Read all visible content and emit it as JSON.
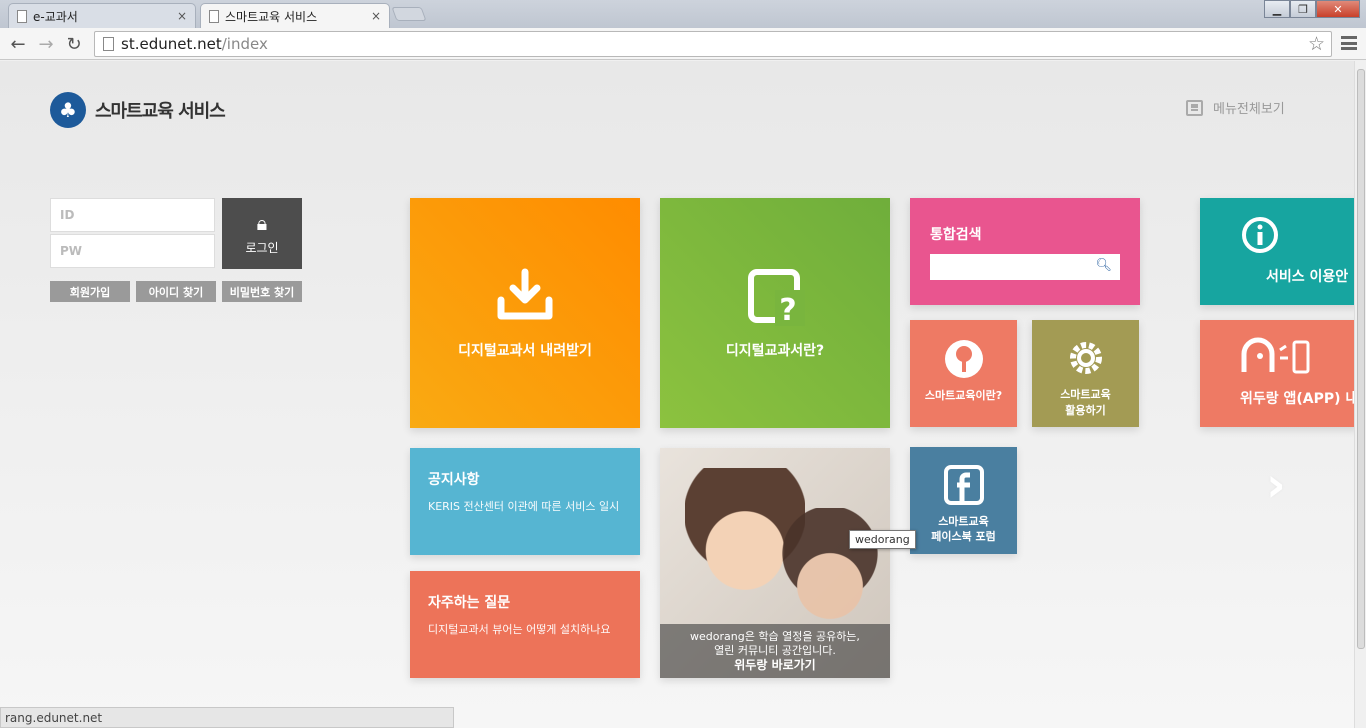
{
  "browser": {
    "tabs": [
      {
        "label": "e-교과서",
        "close": "×"
      },
      {
        "label": "스마트교육 서비스",
        "close": "×"
      }
    ],
    "url_host": "st.edunet.net",
    "url_path": "/index",
    "window_buttons": {
      "minimize": "▁",
      "restore": "❐",
      "close": "✕"
    },
    "status_url": "rang.edunet.net"
  },
  "header": {
    "logo_text": "스마트교육 서비스",
    "menu_all": "메뉴전체보기"
  },
  "login": {
    "id_placeholder": "ID",
    "pw_placeholder": "PW",
    "login_button": "로그인",
    "join": "회원가입",
    "find_id": "아이디 찾기",
    "find_pw": "비밀번호 찾기"
  },
  "tiles": {
    "download": "디지털교과서 내려받기",
    "what_is": "디지털교과서란?",
    "search_title": "통합검색",
    "service_guide": "서비스 이용안",
    "smart_edu_what": "스마트교육이란?",
    "smart_edu_use_1": "스마트교육",
    "smart_edu_use_2": "활용하기",
    "wedorang_app": "위두랑 앱(APP) 내",
    "notice_title": "공지사항",
    "notice_text": "KERIS 전산센터 이관에 따른 서비스 일시",
    "faq_title": "자주하는 질문",
    "faq_text": "디지털교과서 뷰어는 어떻게 설치하나요",
    "facebook_1": "스마트교육",
    "facebook_2": "페이스북 포럼",
    "photo_line1": "wedorang은 학습 열정을 공유하는,",
    "photo_line2": "열린 커뮤니티 공간입니다.",
    "photo_go": "위두랑 바로가기"
  },
  "tooltip": "wedorang",
  "icons": {
    "download": "download-icon",
    "question": "question-doc-icon",
    "info": "info-icon",
    "tree": "tree-icon",
    "gear": "gear-icon",
    "mascot": "mascot-icon",
    "facebook": "facebook-icon",
    "lock": "lock-icon",
    "next": "chevron-right-icon"
  },
  "colors": {
    "orange": "#ff8c00",
    "green": "#7ab63d",
    "pink": "#e9558f",
    "teal": "#17a5a0",
    "salmon": "#ee7a64",
    "olive": "#a39b54",
    "sky": "#56b5d2",
    "facebook": "#4a7fa0",
    "brand": "#1d5a9a"
  }
}
